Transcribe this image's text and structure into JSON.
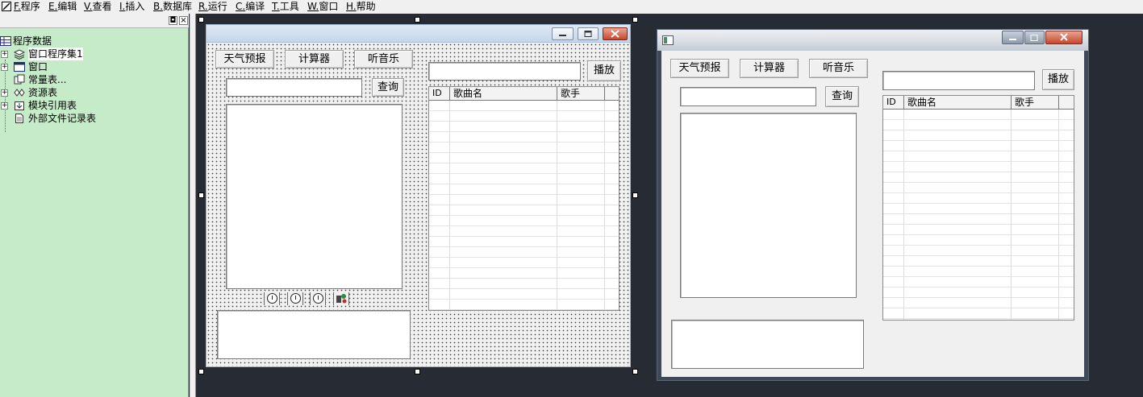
{
  "menubar": {
    "items": [
      {
        "key": "F.",
        "label": "程序"
      },
      {
        "key": "E.",
        "label": "编辑"
      },
      {
        "key": "V.",
        "label": "查看"
      },
      {
        "key": "I.",
        "label": "插入"
      },
      {
        "key": "B.",
        "label": "数据库"
      },
      {
        "key": "R.",
        "label": "运行"
      },
      {
        "key": "C.",
        "label": "编译"
      },
      {
        "key": "T.",
        "label": "工具"
      },
      {
        "key": "W.",
        "label": "窗口"
      },
      {
        "key": "H.",
        "label": "帮助"
      }
    ]
  },
  "tree_panel": {
    "pin_glyph": "◘",
    "close_glyph": "×",
    "root": "程序数据",
    "items": [
      {
        "label": "窗口程序集1",
        "expander": "+",
        "icon": "stack-icon"
      },
      {
        "label": "窗口",
        "expander": "+",
        "icon": "window-icon"
      },
      {
        "label": "常量表...",
        "expander": "",
        "icon": "constant-icon"
      },
      {
        "label": "资源表",
        "expander": "+",
        "icon": "resource-icon"
      },
      {
        "label": "模块引用表",
        "expander": "+",
        "icon": "module-icon"
      },
      {
        "label": "外部文件记录表",
        "expander": "",
        "icon": "file-icon"
      }
    ]
  },
  "designer": {
    "weather_button": "天气预报",
    "calculator_button": "计算器",
    "music_button": "听音乐",
    "query_button": "查询",
    "play_button": "播放",
    "grid_columns": [
      "ID",
      "歌曲名",
      "歌手"
    ],
    "components": [
      "timer-icon",
      "timer-icon",
      "timer-icon",
      "tool-icon"
    ]
  },
  "preview": {
    "weather_button": "天气预报",
    "calculator_button": "计算器",
    "music_button": "听音乐",
    "query_button": "查询",
    "play_button": "播放",
    "grid_columns": [
      "ID",
      "歌曲名",
      "歌手"
    ]
  }
}
